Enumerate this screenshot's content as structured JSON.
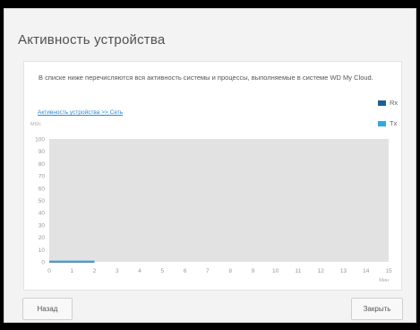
{
  "dialog": {
    "title": "Активность устройства",
    "description": "В списке ниже перечисляются вся активность системы и процессы, выполняемые в системе WD My Cloud.",
    "breadcrumb_link": "Активность устройства >> Сеть",
    "back_label": "Назад",
    "close_label": "Закрыть"
  },
  "legend": [
    {
      "name": "Rx",
      "color": "#1d5f93"
    },
    {
      "name": "Tx",
      "color": "#35a6e8"
    }
  ],
  "chart_data": {
    "type": "area",
    "ylabel": "Мб/с",
    "xlabel": "Мин",
    "xlim": [
      0,
      15
    ],
    "ylim": [
      0,
      100
    ],
    "x_ticks": [
      "0",
      "1",
      "2",
      "3",
      "4",
      "5",
      "6",
      "7",
      "8",
      "9",
      "10",
      "11",
      "12",
      "13",
      "14",
      "15"
    ],
    "y_ticks": [
      "0",
      "10",
      "20",
      "30",
      "40",
      "50",
      "60",
      "70",
      "80",
      "90",
      "100"
    ],
    "grid": false,
    "legend_placement": "top-right",
    "series": [
      {
        "name": "Rx",
        "x": [
          0,
          1,
          2
        ],
        "y": [
          0,
          0,
          0
        ]
      },
      {
        "name": "Tx",
        "x": [
          0,
          1,
          2
        ],
        "y": [
          0.5,
          0.5,
          0.5
        ]
      }
    ]
  }
}
